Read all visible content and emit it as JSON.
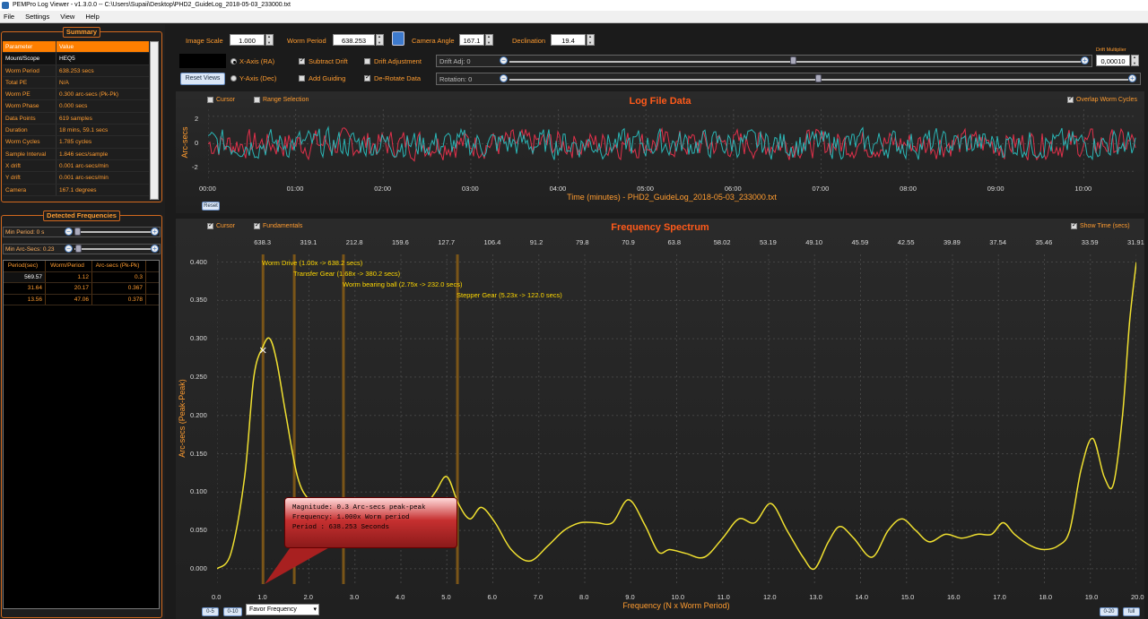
{
  "window": {
    "title": "PEMPro Log Viewer - v1.3.0.0 -- C:\\Users\\Supaii\\Desktop\\PHD2_GuideLog_2018-05-03_233000.txt"
  },
  "menu": [
    "File",
    "Settings",
    "View",
    "Help"
  ],
  "summary": {
    "title": "Summary",
    "header": {
      "param": "Parameter",
      "value": "Value"
    },
    "rows": [
      {
        "p": "Mount/Scope",
        "v": "HEQ5"
      },
      {
        "p": "Worm Period",
        "v": "638.253 secs"
      },
      {
        "p": "Total PE",
        "v": "N/A"
      },
      {
        "p": "Worm PE",
        "v": "0.300 arc-secs (Pk-Pk)"
      },
      {
        "p": "Worm Phase",
        "v": "0.000 secs"
      },
      {
        "p": "Data Points",
        "v": "619 samples"
      },
      {
        "p": "Duration",
        "v": "18 mins, 59.1 secs"
      },
      {
        "p": "Worm Cycles",
        "v": "1.785 cycles"
      },
      {
        "p": "Sample Interval",
        "v": "1.846 secs/sample"
      },
      {
        "p": "X drift",
        "v": "0.001 arc-secs/min"
      },
      {
        "p": "Y drift",
        "v": "0.001 arc-secs/min"
      },
      {
        "p": "Camera",
        "v": "167.1 degrees"
      }
    ]
  },
  "detected": {
    "title": "Detected Frequencies",
    "min_period": "Min Period: 0 s",
    "min_arcsecs": "Min Arc-Secs: 0.23",
    "header": {
      "c1": "Period(sec)",
      "c2": "Worm/Period",
      "c3": "Arc-secs (Pk-Pk)"
    },
    "rows": [
      {
        "c1": "569.57",
        "c2": "1.12",
        "c3": "0.3"
      },
      {
        "c1": "31.64",
        "c2": "20.17",
        "c3": "0.367"
      },
      {
        "c1": "13.56",
        "c2": "47.06",
        "c3": "0.378"
      }
    ]
  },
  "controls": {
    "image_scale_label": "Image Scale",
    "image_scale": "1.000",
    "worm_period_label": "Worm Period",
    "worm_period": "638.253",
    "camera_angle_label": "Camera Angle",
    "camera_angle": "167.1",
    "declination_label": "Declination",
    "declination": "19.4",
    "xaxis": "X-Axis (RA)",
    "yaxis": "Y-Axis (Dec)",
    "subtract_drift": "Subtract Drift",
    "add_guiding": "Add Guiding",
    "drift_adjustment": "Drift Adjustment",
    "derotate": "De-Rotate Data",
    "drift_adj": "Drift Adj: 0",
    "rotation": "Rotation: 0",
    "reset_views": "Reset Views",
    "drift_multiplier_label": "Drift Multiplier",
    "drift_multiplier": "0,00010"
  },
  "log_chart": {
    "title": "Log File Data",
    "cursor": "Cursor",
    "range_selection": "Range Selection",
    "overlap": "Overlap Worm Cycles",
    "xlabel": "Time (minutes) - PHD2_GuideLog_2018-05-03_233000.txt",
    "ylabel": "Arc-secs",
    "yticks": [
      "2",
      "0",
      "-2"
    ],
    "xticks": [
      "00:00",
      "01:00",
      "02:00",
      "03:00",
      "04:00",
      "05:00",
      "06:00",
      "07:00",
      "08:00",
      "09:00",
      "10:00"
    ],
    "reset": "Reset"
  },
  "spec_chart": {
    "title": "Frequency Spectrum",
    "cursor": "Cursor",
    "fundamentals": "Fundamentals",
    "show_time": "Show Time (secs)",
    "xlabel": "Frequency (N x Worm Period)",
    "ylabel": "Arc-secs (Peak-Peak)",
    "topticks": [
      "638.3",
      "319.1",
      "212.8",
      "159.6",
      "127.7",
      "106.4",
      "91.2",
      "79.8",
      "70.9",
      "63.8",
      "58.02",
      "53.19",
      "49.10",
      "45.59",
      "42.55",
      "39.89",
      "37.54",
      "35.46",
      "33.59",
      "31.91"
    ],
    "annotations": [
      "Worm Drive (1.00x -> 638.2 secs)",
      "Transfer Gear (1.68x -> 380.2 secs)",
      "Worm bearing ball (2.75x -> 232.0 secs)",
      "Stepper Gear (5.23x -> 122.0 secs)"
    ],
    "tooltip": {
      "line1": "Magnitude: 0.3 Arc-secs peak-peak",
      "line2": "Frequency: 1.000x Worm period",
      "line3": "Period   : 638.253 Seconds"
    },
    "buttons": {
      "b05": "0-5",
      "b010": "0-10",
      "b020": "0-20",
      "full": "full"
    },
    "favor": "Favor Frequency"
  },
  "chart_data": [
    {
      "type": "line",
      "title": "Log File Data",
      "xlabel": "Time (minutes) - PHD2_GuideLog_2018-05-03_233000.txt",
      "ylabel": "Arc-secs",
      "ylim": [
        -2.5,
        2.5
      ],
      "xlim": [
        0,
        10.6
      ],
      "series": [
        {
          "name": "RA",
          "color": "#e0304a"
        },
        {
          "name": "Dec",
          "color": "#2ab5b5"
        }
      ]
    },
    {
      "type": "line",
      "title": "Frequency Spectrum",
      "xlabel": "Frequency (N x Worm Period)",
      "ylabel": "Arc-secs (Peak-Peak)",
      "xlim": [
        0,
        20
      ],
      "ylim": [
        -0.02,
        0.41
      ],
      "xticks": [
        0,
        1,
        2,
        3,
        4,
        5,
        6,
        7,
        8,
        9,
        10,
        11,
        12,
        13,
        14,
        15,
        16,
        17,
        18,
        19,
        20
      ],
      "yticks": [
        0.0,
        0.05,
        0.1,
        0.15,
        0.2,
        0.25,
        0.3,
        0.35,
        0.4
      ],
      "fundamentals": [
        1.0,
        1.68,
        2.75,
        5.23
      ],
      "series": [
        {
          "name": "Spectrum",
          "color": "#f0e030",
          "x": [
            0,
            0.3,
            0.6,
            0.8,
            1.0,
            1.15,
            1.3,
            1.5,
            1.75,
            2.0,
            2.3,
            2.6,
            3.0,
            3.4,
            3.75,
            4.1,
            4.4,
            4.75,
            5.0,
            5.25,
            5.5,
            5.75,
            6.05,
            6.4,
            6.8,
            7.2,
            7.55,
            7.9,
            8.25,
            8.6,
            8.95,
            9.3,
            9.6,
            9.85,
            10.2,
            10.6,
            11.0,
            11.35,
            11.7,
            12.05,
            12.4,
            12.75,
            13.0,
            13.3,
            13.55,
            13.85,
            14.25,
            14.6,
            14.9,
            15.2,
            15.5,
            15.85,
            16.2,
            16.55,
            16.85,
            17.1,
            17.35,
            17.7,
            18.0,
            18.3,
            18.55,
            18.8,
            19.05,
            19.3,
            19.5,
            19.7,
            19.85,
            20.0
          ],
          "y": [
            0.0,
            0.02,
            0.12,
            0.25,
            0.29,
            0.3,
            0.27,
            0.2,
            0.12,
            0.09,
            0.08,
            0.085,
            0.075,
            0.045,
            0.068,
            0.05,
            0.07,
            0.1,
            0.12,
            0.085,
            0.065,
            0.08,
            0.06,
            0.025,
            0.01,
            0.03,
            0.05,
            0.06,
            0.06,
            0.06,
            0.09,
            0.058,
            0.022,
            0.025,
            0.02,
            0.015,
            0.04,
            0.065,
            0.06,
            0.085,
            0.05,
            0.015,
            0.0,
            0.035,
            0.055,
            0.04,
            0.015,
            0.05,
            0.065,
            0.05,
            0.035,
            0.045,
            0.04,
            0.045,
            0.045,
            0.06,
            0.045,
            0.03,
            0.025,
            0.03,
            0.05,
            0.13,
            0.17,
            0.12,
            0.11,
            0.2,
            0.32,
            0.4
          ]
        }
      ]
    }
  ]
}
